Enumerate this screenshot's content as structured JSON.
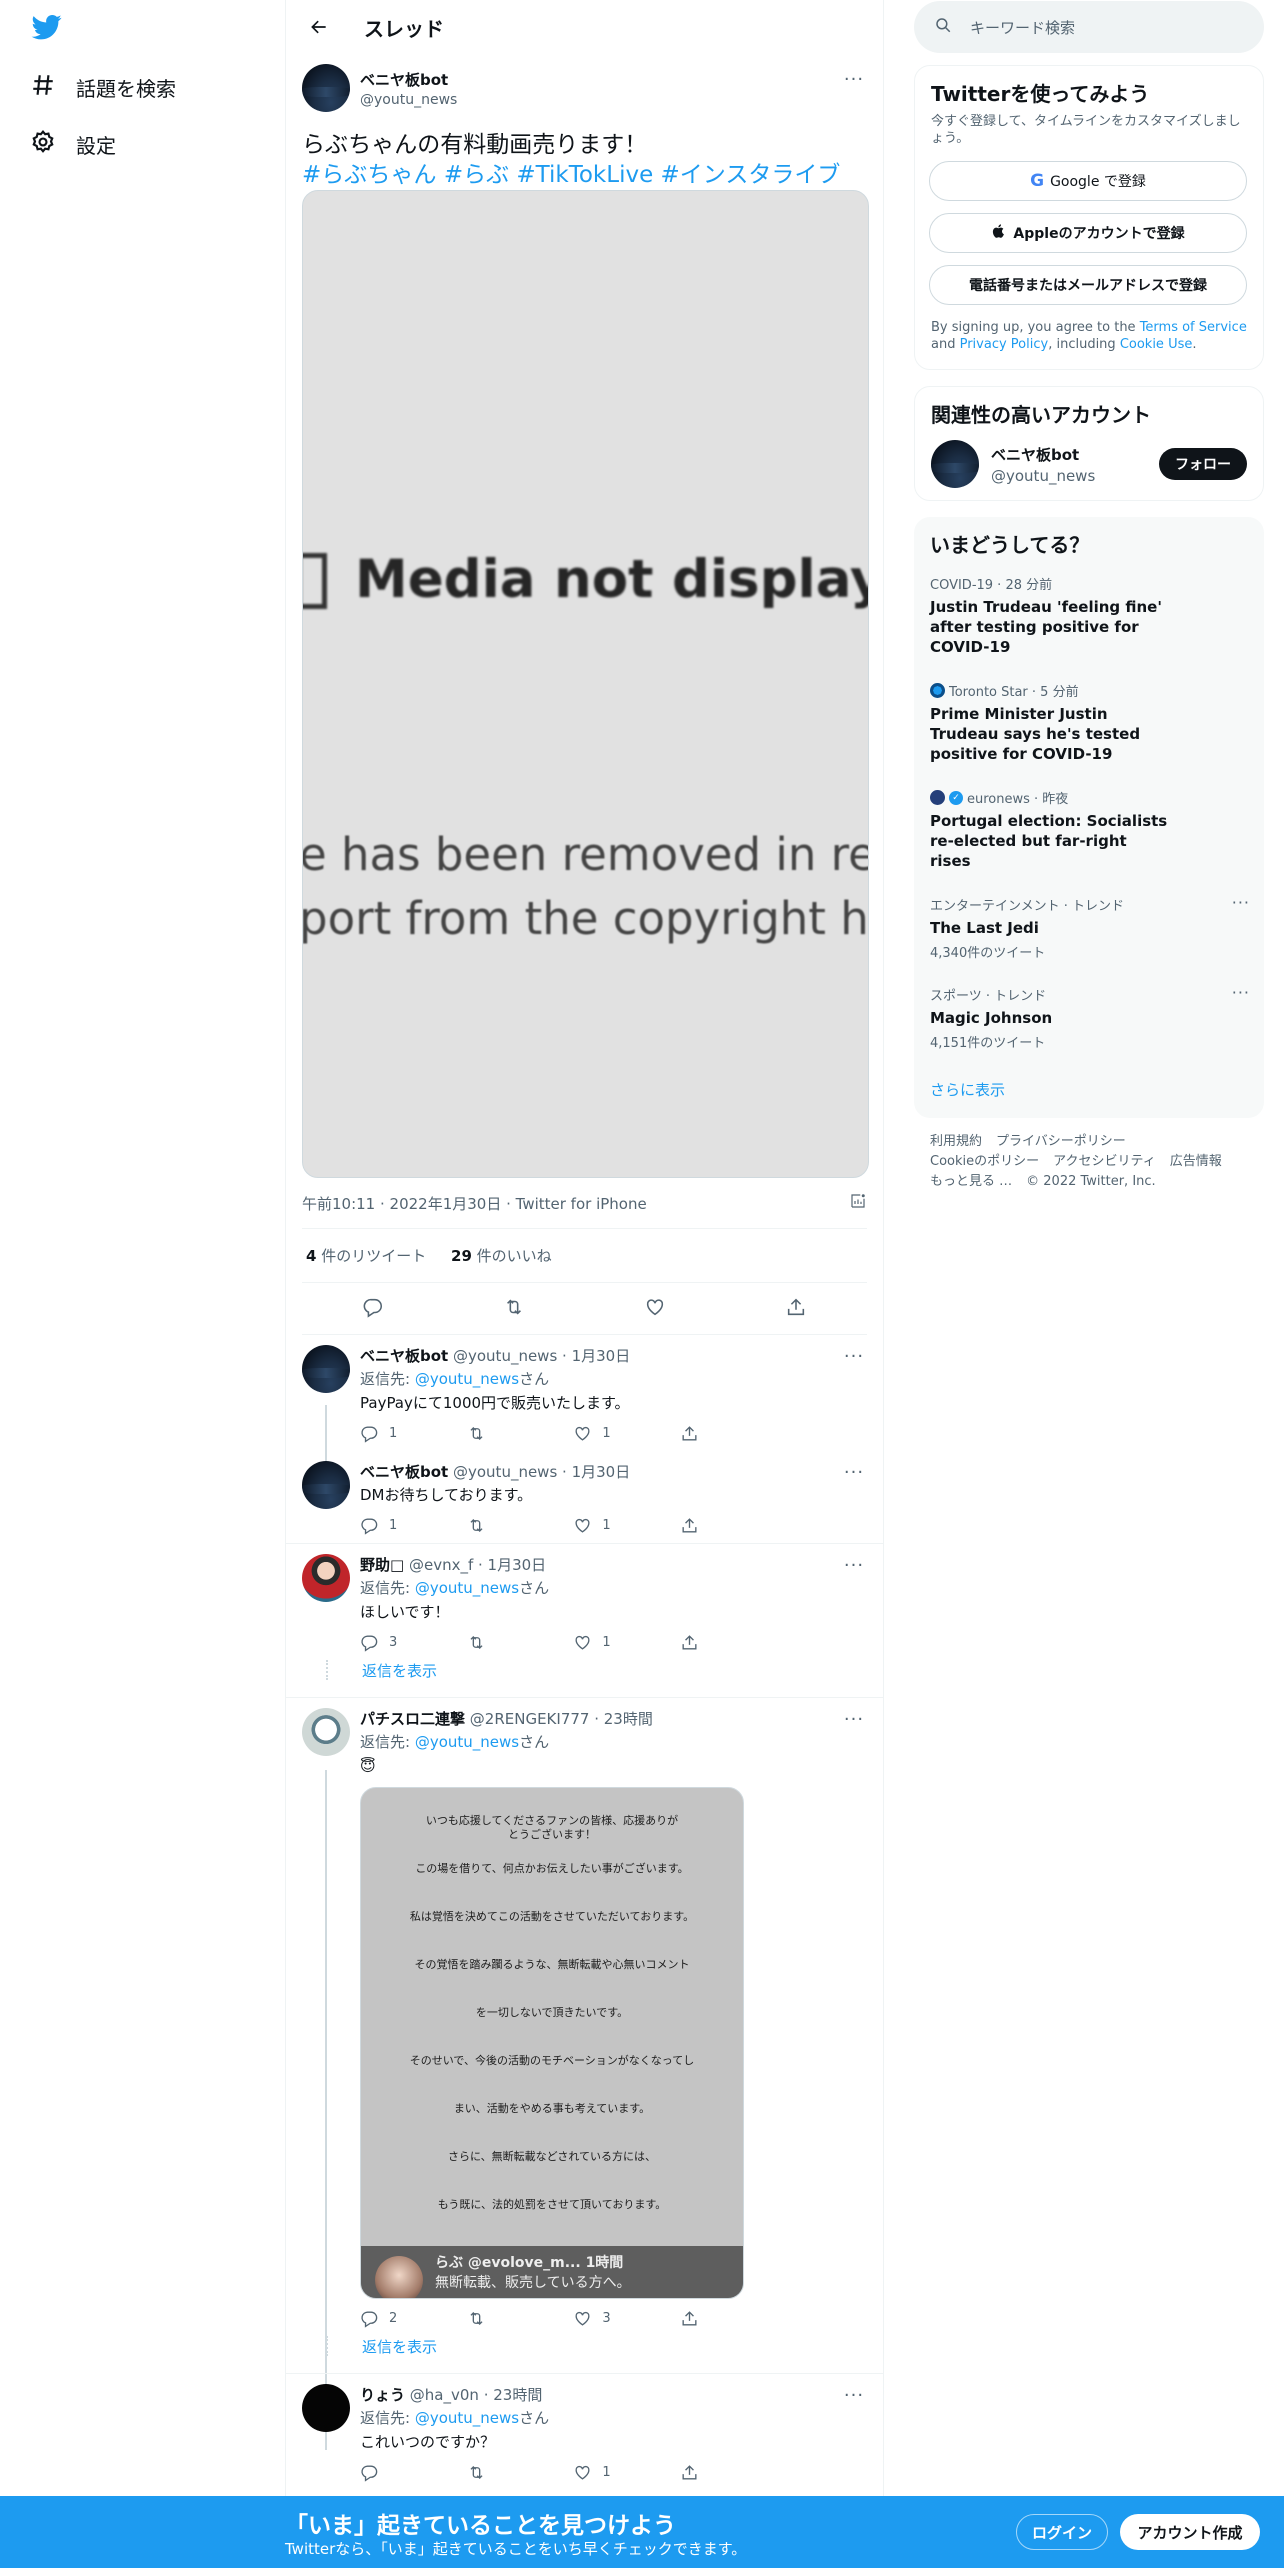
{
  "nav": {
    "logo": "twitter-bird",
    "explore_label": "話題を検索",
    "settings_label": "設定"
  },
  "header": {
    "title": "スレッド"
  },
  "main_tweet": {
    "name": "ベニヤ板bot",
    "handle": "@youtu_news",
    "text": "らぶちゃんの有料動画売ります！",
    "hashtags": "#らぶちゃん #らぶ #TikTokLive #インスタライブ",
    "media": {
      "line1": "Media not displaye",
      "line2": "e has been removed in res",
      "line3": "port from the copyright hold"
    },
    "meta": "午前10:11 · 2022年1月30日 · Twitter for iPhone",
    "retweet_count": "4",
    "retweet_label": "件のリツイート",
    "like_count": "29",
    "like_label": "件のいいね"
  },
  "replies": [
    {
      "name": "ベニヤ板bot",
      "handle_time": "@youtu_news · 1月30日",
      "reply_prefix": "返信先: ",
      "reply_to": "@youtu_news",
      "reply_suffix": "さん",
      "text": "PayPayにて1000円で販売いたします。",
      "replies": "1",
      "retweets": "",
      "likes": "1"
    },
    {
      "name": "ベニヤ板bot",
      "handle_time": "@youtu_news · 1月30日",
      "text": "DMお待ちしております。",
      "replies": "1",
      "retweets": "",
      "likes": "1"
    },
    {
      "name": "野助□",
      "handle_time": "@evnx_f · 1月30日",
      "reply_prefix": "返信先: ",
      "reply_to": "@youtu_news",
      "reply_suffix": "さん",
      "text": "ほしいです！",
      "replies": "3",
      "retweets": "",
      "likes": "1"
    },
    {
      "name": "パチスロ二連撃",
      "handle_time": "@2RENGEKI777 · 23時間",
      "reply_prefix": "返信先: ",
      "reply_to": "@youtu_news",
      "reply_suffix": "さん",
      "text": "😇",
      "replies": "2",
      "retweets": "",
      "likes": "3"
    },
    {
      "name": "りょう",
      "handle_time": "@ha_v0n · 23時間",
      "reply_prefix": "返信先: ",
      "reply_to": "@youtu_news",
      "reply_suffix": "さん",
      "text": "これいつのですか？",
      "replies": "",
      "retweets": "",
      "likes": "1"
    }
  ],
  "show_replies_label": "返信を表示",
  "quote_image": {
    "lines": [
      "いつも応援してくださるファンの皆様、応援ありがとうございます！",
      "この場を借りて、何点かお伝えしたい事がございます。",
      "私は覚悟を決めてこの活動をさせていただいております。",
      "その覚悟を踏み躙るような、無断転載や心無いコメント",
      "を一切しないで頂きたいです。",
      "そのせいで、今後の活動のモチベーションがなくなってし",
      "まい、活動をやめる事も考えています。",
      "さらに、無断転載などされている方には、",
      "もう既に、法的処罰をさせて頂いております。"
    ],
    "overlay_name": "らぶ @evolove_m... 1時間",
    "overlay_text": "無断転載、販売している方へ。"
  },
  "sidebar": {
    "search_placeholder": "キーワード検索",
    "join": {
      "title": "Twitterを使ってみよう",
      "subtitle": "今すぐ登録して、タイムラインをカスタマイズしましょう。",
      "google_label": "Google で登録",
      "apple_label": "Appleのアカウントで登録",
      "phone_label": "電話番号またはメールアドレスで登録",
      "terms_prefix": "By signing up, you agree to the ",
      "terms_link": "Terms of Service",
      "terms_and": " and ",
      "privacy_link": "Privacy Policy",
      "terms_mid": ", including ",
      "cookie_link": "Cookie Use",
      "terms_end": "."
    },
    "relevant": {
      "title": "関連性の高いアカウント",
      "name": "ベニヤ板bot",
      "handle": "@youtu_news",
      "follow_label": "フォロー"
    },
    "trends": {
      "title": "いまどうしてる？",
      "items": [
        {
          "category": "COVID-19 · 28 分前",
          "title": "Justin Trudeau 'feeling fine' after testing positive for COVID-19"
        },
        {
          "category": "Toronto Star · 5 分前",
          "title": "Prime Minister Justin Trudeau says he's tested positive for COVID-19"
        },
        {
          "category": "euronews · 昨夜",
          "title": "Portugal election: Socialists re-elected but far-right rises"
        },
        {
          "category": "エンターテインメント · トレンド",
          "title": "The Last Jedi",
          "count": "4,340件のツイート"
        },
        {
          "category": "スポーツ · トレンド",
          "title": "Magic Johnson",
          "count": "4,151件のツイート"
        }
      ],
      "more_label": "さらに表示"
    },
    "footer": {
      "links": [
        "利用規約",
        "プライバシーポリシー",
        "Cookieのポリシー",
        "アクセシビリティ",
        "広告情報",
        "もっと見る …"
      ],
      "copyright": "© 2022 Twitter, Inc."
    }
  },
  "bottom_bar": {
    "headline": "「いま」起きていることを見つけよう",
    "subline": "Twitterなら、「いま」起きていることをいち早くチェックできます。",
    "login_label": "ログイン",
    "signup_label": "アカウント作成"
  },
  "colors": {
    "accent": "#1d9bf0",
    "text": "#0f1419",
    "muted": "#536471"
  }
}
